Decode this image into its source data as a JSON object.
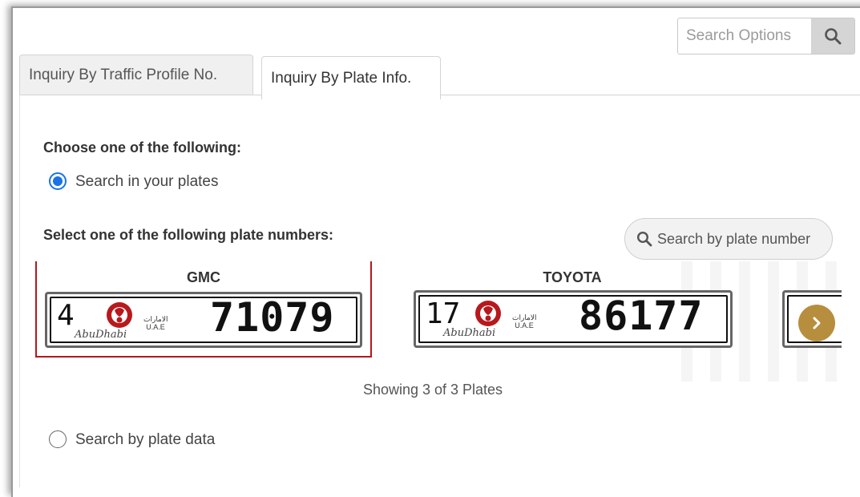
{
  "header": {
    "search_placeholder": "Search Options",
    "search_icon": "search-icon"
  },
  "tabs": [
    {
      "label": "Inquiry By Traffic Profile No.",
      "active": false
    },
    {
      "label": "Inquiry By Plate Info.",
      "active": true
    }
  ],
  "form": {
    "choose_heading": "Choose one of the following:",
    "option_your_plates": "Search in your plates",
    "option_your_plates_selected": true,
    "select_heading": "Select one of the following plate numbers:",
    "plate_search_placeholder": "Search by plate number",
    "option_plate_data": "Search by plate data",
    "option_plate_data_selected": false
  },
  "plates": [
    {
      "make": "GMC",
      "code": "4",
      "number": "71079",
      "city": "AbuDhabi",
      "selected": true
    },
    {
      "make": "TOYOTA",
      "code": "17",
      "number": "86177",
      "city": "AbuDhabi",
      "selected": false
    }
  ],
  "plate_badge": {
    "arabic": "الامارات",
    "latin": "U.A.E"
  },
  "carousel": {
    "status": "Showing 3 of 3 Plates",
    "next_icon": "chevron-right-icon"
  },
  "colors": {
    "accent": "#1a73e8",
    "selected_border": "#b3181b",
    "next_button": "#b78e3e"
  }
}
